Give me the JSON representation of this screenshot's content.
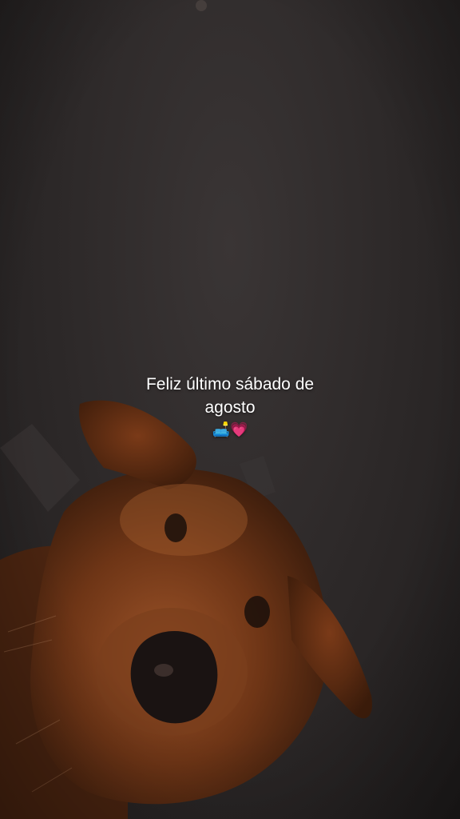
{
  "caption": {
    "line1": "Feliz último sábado de",
    "line2": "agosto",
    "emojis": "🛋️💗"
  },
  "scene": {
    "subject": "golden-dog-peeking-from-below",
    "colors": {
      "background": "#2e2a2a",
      "fur_dark": "#5a2a12",
      "fur_mid": "#8a4a22",
      "fur_light": "#b0683a",
      "nose": "#1a1312"
    }
  }
}
